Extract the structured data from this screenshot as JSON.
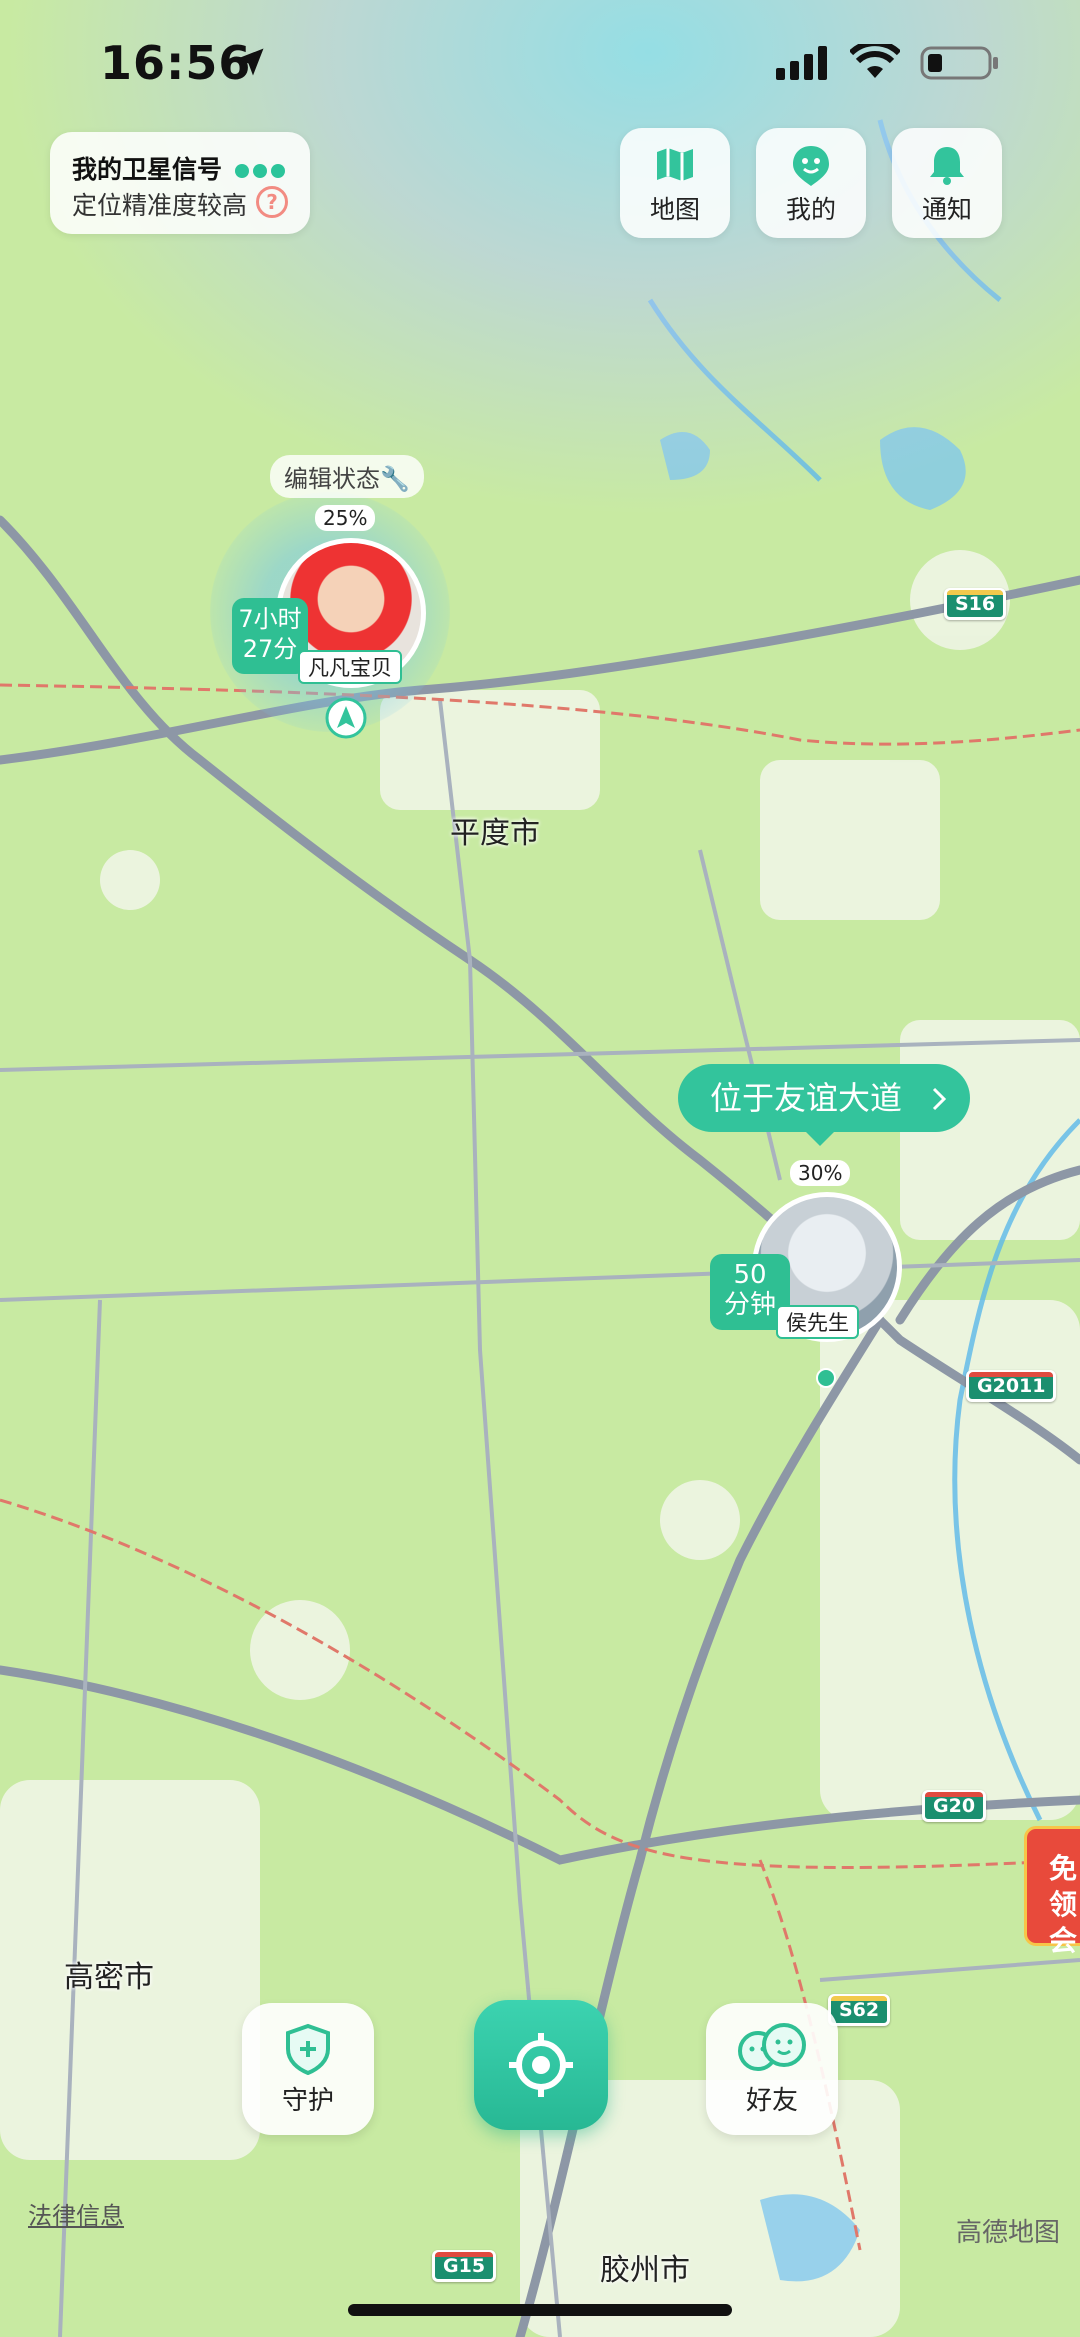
{
  "status_bar": {
    "time": "16:56"
  },
  "satellite": {
    "title": "我的卫星信号",
    "subtitle": "定位精准度较高",
    "help_icon": "?"
  },
  "top_buttons": [
    {
      "label": "地图",
      "icon": "map-icon"
    },
    {
      "label": "我的",
      "icon": "face-icon"
    },
    {
      "label": "通知",
      "icon": "bell-icon"
    }
  ],
  "members": [
    {
      "edit_label": "编辑状态🔧",
      "battery": "25%",
      "time_line1": "7小时",
      "time_line2": "27分",
      "name": "凡凡宝贝"
    },
    {
      "location": "位于友谊大道",
      "battery": "30%",
      "time_line1": "50",
      "time_line2": "分钟",
      "name": "侯先生"
    }
  ],
  "map_labels": {
    "cities": [
      "平度市",
      "高密市",
      "胶州市"
    ],
    "roads": [
      "S16",
      "G2011",
      "G20",
      "S62",
      "G15"
    ],
    "legal": "法律信息",
    "provider": "高德地图",
    "promo": "免领会"
  },
  "bottom_bar": {
    "guard": "守护",
    "friends": "好友"
  },
  "colors": {
    "accent": "#2fbf93",
    "map_green": "#c9e8a6"
  }
}
